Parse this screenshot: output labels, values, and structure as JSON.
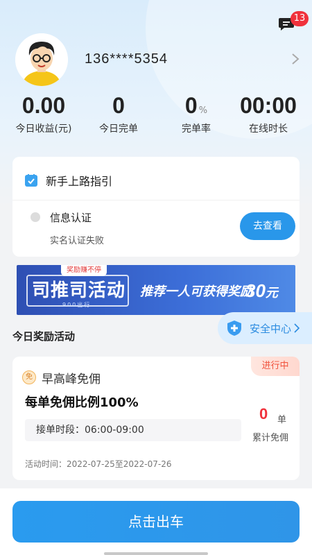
{
  "header": {
    "message_badge": "13",
    "phone": "136****5354"
  },
  "stats": [
    {
      "value": "0.00",
      "unit": "",
      "label": "今日收益(元)"
    },
    {
      "value": "0",
      "unit": "",
      "label": "今日完单"
    },
    {
      "value": "0",
      "unit": "%",
      "label": "完单率"
    },
    {
      "value": "00:00",
      "unit": "",
      "label": "在线时长"
    }
  ],
  "guide": {
    "title": "新手上路指引",
    "item_title": "信息认证",
    "item_status": "实名认证失败",
    "button": "去查看"
  },
  "banner": {
    "tag": "奖励赚不停",
    "headline": "司推司活动",
    "sub": "900出行",
    "slogan": "推荐一人可获得奖励",
    "amount": "30",
    "amount_unit": "元"
  },
  "rewards": {
    "section_title": "今日奖励活动",
    "safety_center": "安全中心",
    "status": "进行中",
    "badge": "免",
    "name": "早高峰免佣",
    "main": "每单免佣比例100%",
    "period": "接单时段：06:00-09:00",
    "count": "0",
    "count_unit": "单",
    "count_label": "累计免佣",
    "time": "活动时间：2022-07-25至2022-07-26"
  },
  "footer": {
    "go_button": "点击出车"
  },
  "colors": {
    "accent": "#2997ea",
    "danger": "#f0323c"
  }
}
